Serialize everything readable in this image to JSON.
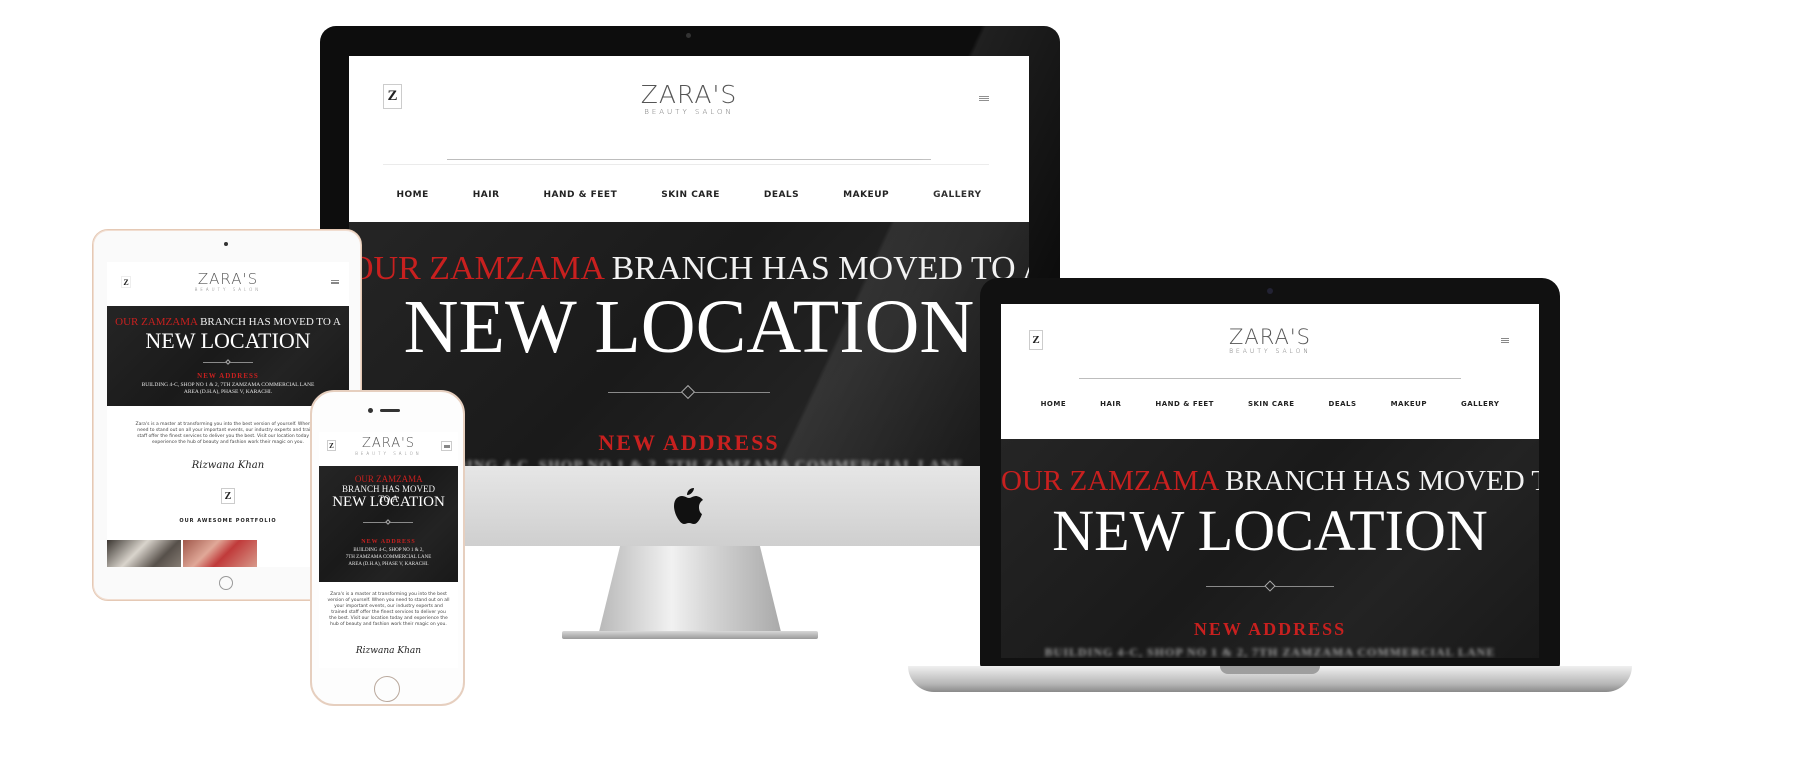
{
  "site": {
    "logo_mark": "Z",
    "brand_name": "ZARA'S",
    "brand_sub": "BEAUTY SALON",
    "nav": [
      "HOME",
      "HAIR",
      "HAND & FEET",
      "SKIN CARE",
      "DEALS",
      "MAKEUP",
      "GALLERY"
    ],
    "headline_red": "OUR ZAMZAMA",
    "headline_rest": "BRANCH HAS MOVED TO A",
    "headline_big": "NEW LOCATION",
    "address_title": "NEW ADDRESS",
    "address_blur": "BUILDING 4-C, SHOP NO 1 & 2, 7TH ZAMZAMA COMMERCIAL LANE",
    "address_line1": "BUILDING 4-C, SHOP NO 1 & 2,",
    "address_line2": "7TH ZAMZAMA COMMERCIAL LANE",
    "address_line3": "AREA (D.H.A), PHASE V, KARACHI.",
    "tablet_address_line1": "BUILDING 4-C, SHOP NO 1 & 2, 7TH ZAMZAMA COMMERCIAL LANE",
    "tablet_address_line2": "AREA (D.H.A), PHASE V, KARACHI.",
    "about_text": "Zara's is a master at transforming you into the best version of yourself. When you need to stand out on all your important events, our industry experts and trained staff offer the finest services to deliver you the best. Visit our location today and experience the hub of beauty and fashion work their magic on you.",
    "signature": "Rizwana Khan",
    "portfolio_title": "OUR AWESOME PORTFOLIO"
  },
  "colors": {
    "accent_red": "#c8201f",
    "hero_bg": "#1f1f1f"
  },
  "icons": {
    "logo": "z-hourglass-icon",
    "menu": "hamburger-menu-icon",
    "apple": "apple-logo-icon"
  }
}
